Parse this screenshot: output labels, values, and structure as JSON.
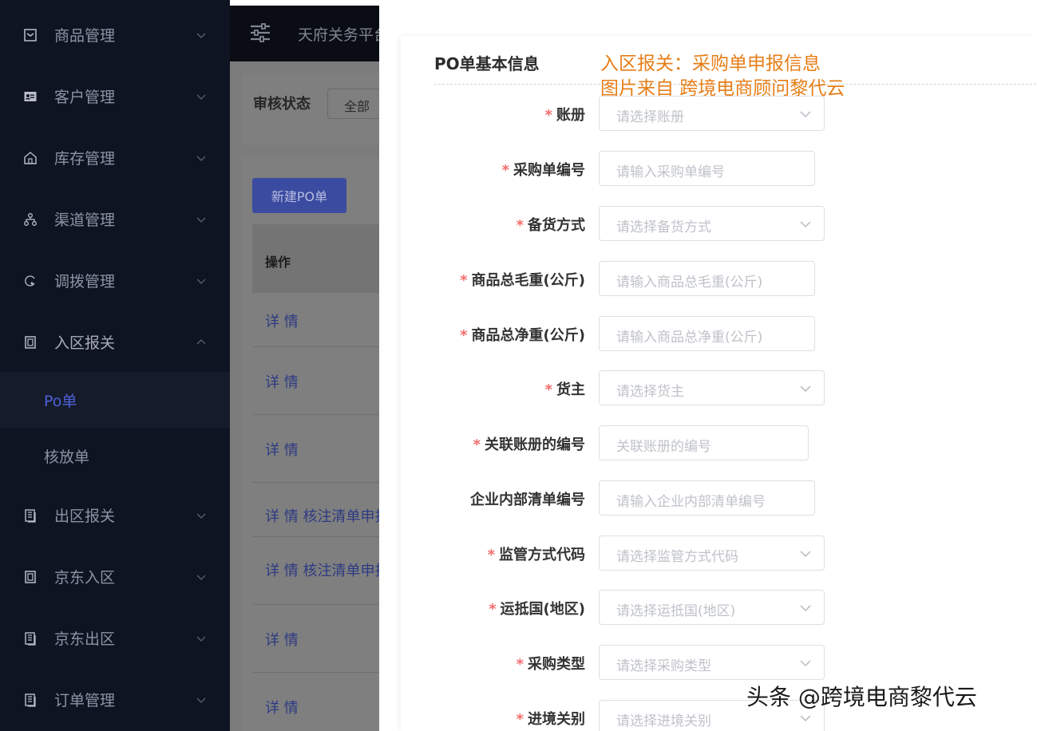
{
  "sidebar": {
    "items": [
      {
        "label": "商品管理",
        "icon": "product-icon"
      },
      {
        "label": "客户管理",
        "icon": "customer-card-icon"
      },
      {
        "label": "库存管理",
        "icon": "warehouse-home-icon"
      },
      {
        "label": "渠道管理",
        "icon": "channel-tree-icon"
      },
      {
        "label": "调拨管理",
        "icon": "transfer-icon"
      },
      {
        "label": "入区报关",
        "icon": "document-icon"
      },
      {
        "label": "出区报关",
        "icon": "files-icon"
      },
      {
        "label": "京东入区",
        "icon": "document-icon"
      },
      {
        "label": "京东出区",
        "icon": "files-icon"
      },
      {
        "label": "订单管理",
        "icon": "files-icon"
      }
    ],
    "submenu": {
      "active": "Po单",
      "other": "核放单"
    }
  },
  "background": {
    "header_title": "天府关务平台",
    "filter_label": "审核状态",
    "filter_value": "全部",
    "new_button": "新建PO单",
    "table_header": "操作",
    "rows": [
      "详 情",
      "详 情",
      "详 情",
      "详 情   核注清单申报",
      "详 情   核注清单申报",
      "详 情",
      "详 情"
    ]
  },
  "form": {
    "section_title": "PO单基本信息",
    "annotation_line1": "入区报关：采购单申报信息",
    "annotation_line2": "图片来自 跨境电商顾问黎代云",
    "fields": [
      {
        "label": "账册",
        "required": "*",
        "placeholder": "请选择账册"
      },
      {
        "label": "采购单编号",
        "required": "*",
        "placeholder": "请输入采购单编号"
      },
      {
        "label": "备货方式",
        "required": "*",
        "placeholder": "请选择备货方式"
      },
      {
        "label": "商品总毛重(公斤)",
        "required": "*",
        "placeholder": "请输入商品总毛重(公斤)"
      },
      {
        "label": "商品总净重(公斤)",
        "required": "*",
        "placeholder": "请输入商品总净重(公斤)"
      },
      {
        "label": "货主",
        "required": "*",
        "placeholder": "请选择货主"
      },
      {
        "label": "关联账册的编号",
        "required": "*",
        "placeholder": "关联账册的编号"
      },
      {
        "label": "企业内部清单编号",
        "required": "",
        "placeholder": "请输入企业内部清单编号"
      },
      {
        "label": "监管方式代码",
        "required": "*",
        "placeholder": "请选择监管方式代码"
      },
      {
        "label": "运抵国(地区)",
        "required": "*",
        "placeholder": "请选择运抵国(地区)"
      },
      {
        "label": "采购类型",
        "required": "*",
        "placeholder": "请选择采购类型"
      },
      {
        "label": "进境关别",
        "required": "*",
        "placeholder": "请选择进境关别"
      }
    ]
  },
  "watermark": "头条 @跨境电商黎代云",
  "colors": {
    "sidebar_bg": "#0e1422",
    "active_blue": "#4e60d6",
    "required_red": "#f56c6c",
    "annotation_orange": "#e67e17"
  }
}
